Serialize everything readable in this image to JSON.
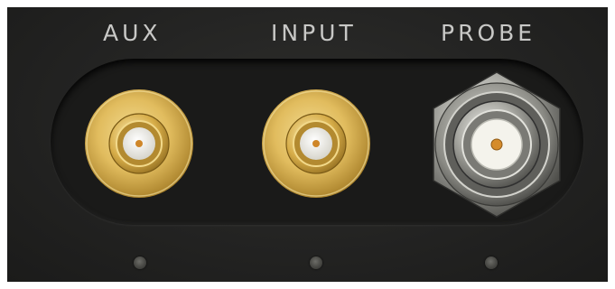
{
  "labels": {
    "aux": "AUX",
    "input": "INPUT",
    "probe": "PROBE"
  },
  "connectors": [
    {
      "name": "aux",
      "kind": "sma-gold"
    },
    {
      "name": "input",
      "kind": "sma-gold"
    },
    {
      "name": "probe",
      "kind": "bnc-nickel"
    }
  ],
  "colors": {
    "panel": "#242423",
    "gold": "#e8c66a",
    "gold_dark": "#b8902c",
    "nickel": "#c9c9c4",
    "insulator": "#f2f2ec",
    "pin": "#d08a2a",
    "label": "#c8c8c6"
  },
  "indicators": [
    "led",
    "led",
    "led"
  ]
}
